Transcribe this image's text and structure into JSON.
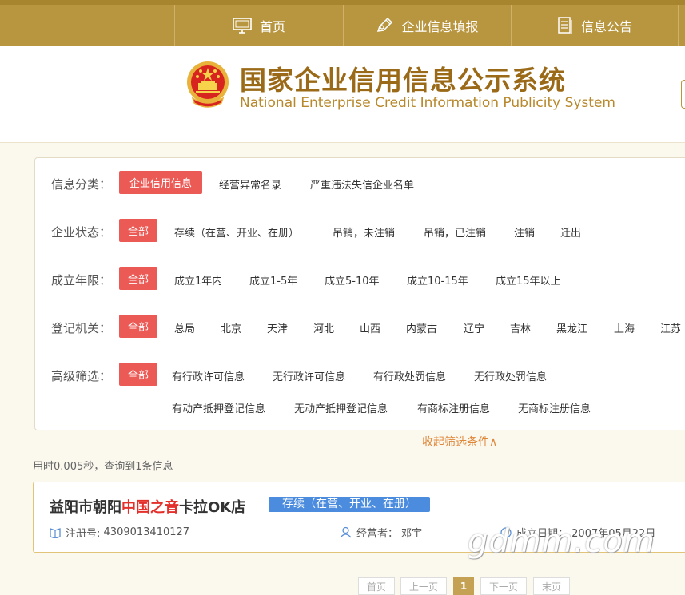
{
  "nav": {
    "items": [
      {
        "label": "首页",
        "icon": "monitor-icon"
      },
      {
        "label": "企业信息填报",
        "icon": "edit-pen-icon"
      },
      {
        "label": "信息公告",
        "icon": "document-icon"
      }
    ]
  },
  "header": {
    "title_cn": "国家企业信用信息公示系统",
    "title_en": "National Enterprise Credit Information Publicity System"
  },
  "filters": {
    "category": {
      "label": "信息分类：",
      "options": [
        "企业信用信息",
        "经营异常名录",
        "严重违法失信企业名单"
      ],
      "selected": "企业信用信息"
    },
    "status": {
      "label": "企业状态：",
      "options": [
        "全部",
        "存续（在营、开业、在册）",
        "吊销，未注销",
        "吊销，已注销",
        "注销",
        "迁出"
      ],
      "selected": "全部"
    },
    "age": {
      "label": "成立年限：",
      "options": [
        "全部",
        "成立1年内",
        "成立1-5年",
        "成立5-10年",
        "成立10-15年",
        "成立15年以上"
      ],
      "selected": "全部"
    },
    "authority": {
      "label": "登记机关：",
      "options": [
        "全部",
        "总局",
        "北京",
        "天津",
        "河北",
        "山西",
        "内蒙古",
        "辽宁",
        "吉林",
        "黑龙江",
        "上海",
        "江苏"
      ],
      "selected": "全部"
    },
    "advanced": {
      "label": "高级筛选：",
      "options": [
        "全部",
        "有行政许可信息",
        "无行政许可信息",
        "有行政处罚信息",
        "无行政处罚信息",
        "有动产抵押登记信息",
        "无动产抵押登记信息",
        "有商标注册信息",
        "无商标注册信息"
      ],
      "selected": "全部"
    },
    "collapse_label": "收起筛选条件∧"
  },
  "stats": {
    "prefix": "用时",
    "time": "0.005",
    "mid": "秒，查询到",
    "count": "1",
    "suffix": "条信息"
  },
  "result": {
    "name_pre": "益阳市朝阳",
    "name_hl": "中国之音",
    "name_post": "卡拉OK店",
    "status": "存续（在营、开业、在册）",
    "reg_label": "注册号:",
    "reg_no": "4309013410127",
    "operator_label": "经营者：",
    "operator": "邓宇",
    "date_label": "成立日期：",
    "date": "2007年05月22日"
  },
  "watermark": "gdmm.com",
  "pagination": {
    "first": "首页",
    "prev": "上一页",
    "current": "1",
    "next": "下一页",
    "last": "末页"
  },
  "colors": {
    "nav_bg": "#b8953f",
    "selected": "#ec5a56",
    "badge": "#4c8cdf",
    "highlight": "#e4302b",
    "title": "#9a6a18"
  }
}
